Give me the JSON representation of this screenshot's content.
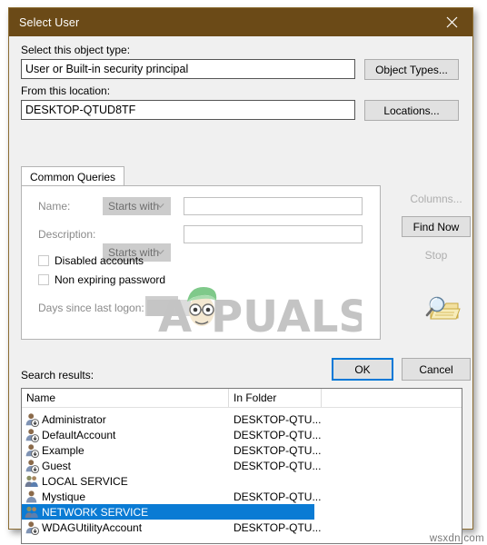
{
  "window": {
    "title": "Select User",
    "close_icon": "close-icon"
  },
  "object_type": {
    "label": "Select this object type:",
    "value": "User or Built-in security principal",
    "button": "Object Types..."
  },
  "location": {
    "label": "From this location:",
    "value": "DESKTOP-QTUD8TF",
    "button": "Locations..."
  },
  "tabs": [
    {
      "label": "Common Queries",
      "active": true
    }
  ],
  "query": {
    "name_label": "Name:",
    "name_operator": "Starts with",
    "name_value": "",
    "description_label": "Description:",
    "description_operator": "Starts with",
    "description_value": "",
    "disabled_accounts_label": "Disabled accounts",
    "disabled_accounts_checked": false,
    "non_expiring_password_label": "Non expiring password",
    "non_expiring_password_checked": false,
    "days_since_last_logon_label": "Days since last logon:",
    "days_since_last_logon_value": ""
  },
  "side_buttons": {
    "columns": "Columns...",
    "find_now": "Find Now",
    "stop": "Stop",
    "search_icon": "magnifier-folder-icon"
  },
  "actions": {
    "ok": "OK",
    "cancel": "Cancel"
  },
  "search_results": {
    "label": "Search results:",
    "columns": [
      "Name",
      "In Folder",
      ""
    ],
    "rows": [
      {
        "name": "Administrator",
        "folder": "DESKTOP-QTU...",
        "icon": "user-account-icon",
        "selected": false
      },
      {
        "name": "DefaultAccount",
        "folder": "DESKTOP-QTU...",
        "icon": "user-account-icon",
        "selected": false
      },
      {
        "name": "Example",
        "folder": "DESKTOP-QTU...",
        "icon": "user-account-icon",
        "selected": false
      },
      {
        "name": "Guest",
        "folder": "DESKTOP-QTU...",
        "icon": "user-account-icon",
        "selected": false
      },
      {
        "name": "LOCAL SERVICE",
        "folder": "",
        "icon": "group-account-icon",
        "selected": false
      },
      {
        "name": "Mystique",
        "folder": "DESKTOP-QTU...",
        "icon": "user-icon",
        "selected": false
      },
      {
        "name": "NETWORK SERVICE",
        "folder": "",
        "icon": "group-account-icon",
        "selected": true
      },
      {
        "name": "WDAGUtilityAccount",
        "folder": "DESKTOP-QTU...",
        "icon": "user-account-icon",
        "selected": false
      }
    ]
  },
  "watermarks": {
    "brand": "PUALS",
    "brand_prefix": "A",
    "corner": "wsxdn.com"
  },
  "colors": {
    "titlebar": "#6b4a17",
    "selection": "#0a7bd4",
    "focus_ring": "#0078d7",
    "dialog_bg": "#f0f0f0"
  }
}
